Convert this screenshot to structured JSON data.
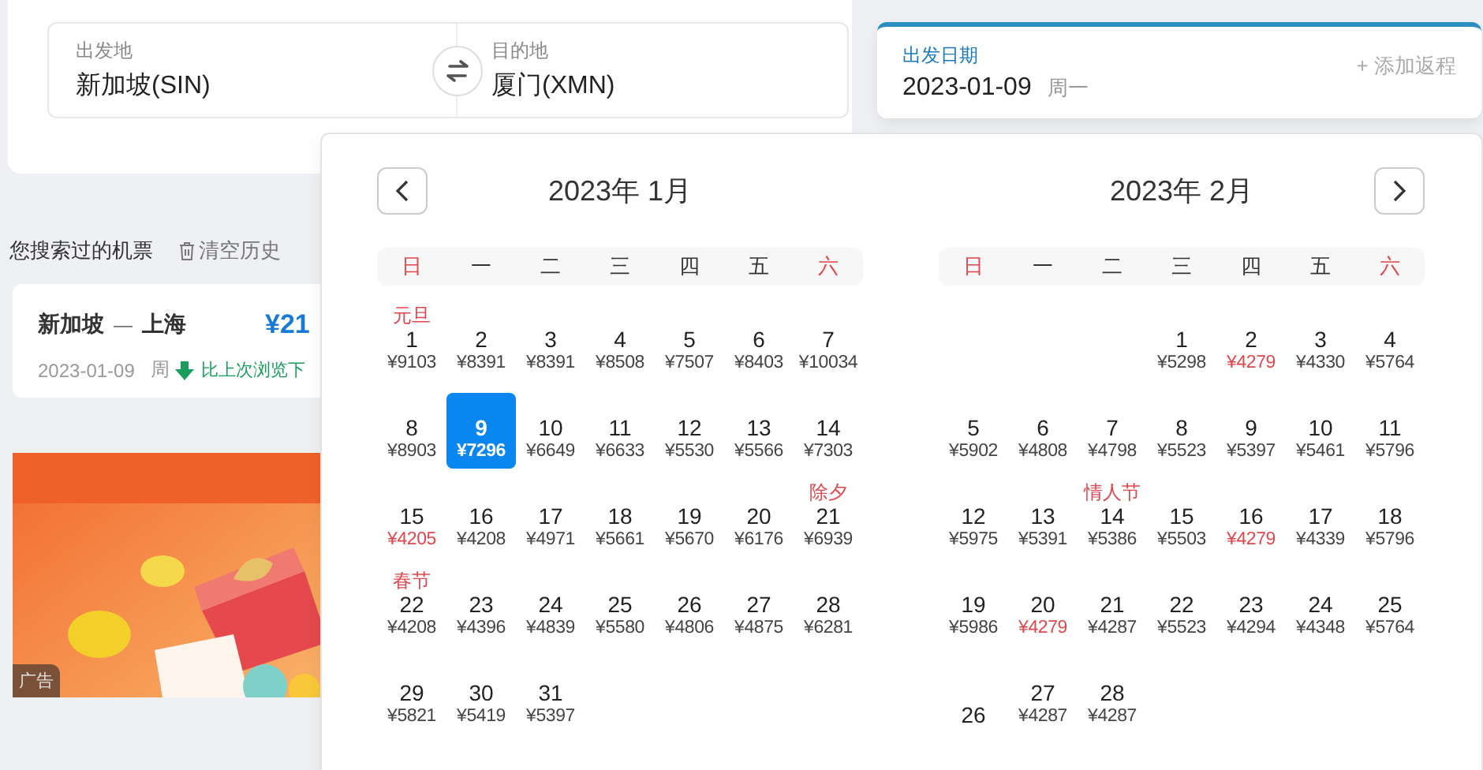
{
  "search": {
    "origin": {
      "label": "出发地",
      "value": "新加坡(SIN)"
    },
    "destination": {
      "label": "目的地",
      "value": "厦门(XMN)"
    },
    "date": {
      "label": "出发日期",
      "value": "2023-01-09",
      "weekday": "周一",
      "add_return": "+ 添加返程"
    }
  },
  "history": {
    "title": "您搜索过的机票",
    "clear": "清空历史",
    "items": [
      {
        "from": "新加坡",
        "separator": "—",
        "to": "上海",
        "price": "¥21",
        "date": "2023-01-09",
        "weekday": "周",
        "trend": "比上次浏览下"
      }
    ]
  },
  "ad": {
    "kind": "picture",
    "badge": "广告"
  },
  "calendar": {
    "months": [
      {
        "title": "2023年 1月",
        "weekdays": [
          {
            "label": "日",
            "weekend": true
          },
          {
            "label": "一",
            "weekend": false
          },
          {
            "label": "二",
            "weekend": false
          },
          {
            "label": "三",
            "weekend": false
          },
          {
            "label": "四",
            "weekend": false
          },
          {
            "label": "五",
            "weekend": false
          },
          {
            "label": "六",
            "weekend": true
          }
        ],
        "days": [
          {
            "kind": "day",
            "day": "1",
            "price": "¥9103",
            "holiday": "元旦",
            "low": false,
            "selected": false
          },
          {
            "kind": "day",
            "day": "2",
            "price": "¥8391",
            "low": false,
            "selected": false
          },
          {
            "kind": "day",
            "day": "3",
            "price": "¥8391",
            "low": false,
            "selected": false
          },
          {
            "kind": "day",
            "day": "4",
            "price": "¥8508",
            "low": false,
            "selected": false
          },
          {
            "kind": "day",
            "day": "5",
            "price": "¥7507",
            "low": false,
            "selected": false
          },
          {
            "kind": "day",
            "day": "6",
            "price": "¥8403",
            "low": false,
            "selected": false
          },
          {
            "kind": "day",
            "day": "7",
            "price": "¥10034",
            "low": false,
            "selected": false
          },
          {
            "kind": "day",
            "day": "8",
            "price": "¥8903",
            "low": false,
            "selected": false
          },
          {
            "kind": "day",
            "day": "9",
            "price": "¥7296",
            "low": false,
            "selected": true
          },
          {
            "kind": "day",
            "day": "10",
            "price": "¥6649",
            "low": false,
            "selected": false
          },
          {
            "kind": "day",
            "day": "11",
            "price": "¥6633",
            "low": false,
            "selected": false
          },
          {
            "kind": "day",
            "day": "12",
            "price": "¥5530",
            "low": false,
            "selected": false
          },
          {
            "kind": "day",
            "day": "13",
            "price": "¥5566",
            "low": false,
            "selected": false
          },
          {
            "kind": "day",
            "day": "14",
            "price": "¥7303",
            "low": false,
            "selected": false
          },
          {
            "kind": "day",
            "day": "15",
            "price": "¥4205",
            "low": true,
            "selected": false
          },
          {
            "kind": "day",
            "day": "16",
            "price": "¥4208",
            "low": false,
            "selected": false
          },
          {
            "kind": "day",
            "day": "17",
            "price": "¥4971",
            "low": false,
            "selected": false
          },
          {
            "kind": "day",
            "day": "18",
            "price": "¥5661",
            "low": false,
            "selected": false
          },
          {
            "kind": "day",
            "day": "19",
            "price": "¥5670",
            "low": false,
            "selected": false
          },
          {
            "kind": "day",
            "day": "20",
            "price": "¥6176",
            "low": false,
            "selected": false
          },
          {
            "kind": "day",
            "day": "21",
            "price": "¥6939",
            "holiday": "除夕",
            "low": false,
            "selected": false
          },
          {
            "kind": "day",
            "day": "22",
            "price": "¥4208",
            "holiday": "春节",
            "low": false,
            "selected": false
          },
          {
            "kind": "day",
            "day": "23",
            "price": "¥4396",
            "low": false,
            "selected": false
          },
          {
            "kind": "day",
            "day": "24",
            "price": "¥4839",
            "low": false,
            "selected": false
          },
          {
            "kind": "day",
            "day": "25",
            "price": "¥5580",
            "low": false,
            "selected": false
          },
          {
            "kind": "day",
            "day": "26",
            "price": "¥4806",
            "low": false,
            "selected": false
          },
          {
            "kind": "day",
            "day": "27",
            "price": "¥4875",
            "low": false,
            "selected": false
          },
          {
            "kind": "day",
            "day": "28",
            "price": "¥6281",
            "low": false,
            "selected": false
          },
          {
            "kind": "day",
            "day": "29",
            "price": "¥5821",
            "low": false,
            "selected": false
          },
          {
            "kind": "day",
            "day": "30",
            "price": "¥5419",
            "low": false,
            "selected": false
          },
          {
            "kind": "day",
            "day": "31",
            "price": "¥5397",
            "low": false,
            "selected": false
          }
        ]
      },
      {
        "title": "2023年 2月",
        "weekdays": [
          {
            "label": "日",
            "weekend": true
          },
          {
            "label": "一",
            "weekend": false
          },
          {
            "label": "二",
            "weekend": false
          },
          {
            "label": "三",
            "weekend": false
          },
          {
            "label": "四",
            "weekend": false
          },
          {
            "label": "五",
            "weekend": false
          },
          {
            "label": "六",
            "weekend": true
          }
        ],
        "days": [
          {
            "kind": "blank"
          },
          {
            "kind": "blank"
          },
          {
            "kind": "blank"
          },
          {
            "kind": "day",
            "day": "1",
            "price": "¥5298",
            "low": false,
            "selected": false
          },
          {
            "kind": "day",
            "day": "2",
            "price": "¥4279",
            "low": true,
            "selected": false
          },
          {
            "kind": "day",
            "day": "3",
            "price": "¥4330",
            "low": false,
            "selected": false
          },
          {
            "kind": "day",
            "day": "4",
            "price": "¥5764",
            "low": false,
            "selected": false
          },
          {
            "kind": "day",
            "day": "5",
            "price": "¥5902",
            "low": false,
            "selected": false
          },
          {
            "kind": "day",
            "day": "6",
            "price": "¥4808",
            "low": false,
            "selected": false
          },
          {
            "kind": "day",
            "day": "7",
            "price": "¥4798",
            "low": false,
            "selected": false
          },
          {
            "kind": "day",
            "day": "8",
            "price": "¥5523",
            "low": false,
            "selected": false
          },
          {
            "kind": "day",
            "day": "9",
            "price": "¥5397",
            "low": false,
            "selected": false
          },
          {
            "kind": "day",
            "day": "10",
            "price": "¥5461",
            "low": false,
            "selected": false
          },
          {
            "kind": "day",
            "day": "11",
            "price": "¥5796",
            "low": false,
            "selected": false
          },
          {
            "kind": "day",
            "day": "12",
            "price": "¥5975",
            "low": false,
            "selected": false
          },
          {
            "kind": "day",
            "day": "13",
            "price": "¥5391",
            "low": false,
            "selected": false
          },
          {
            "kind": "day",
            "day": "14",
            "price": "¥5386",
            "holiday": "情人节",
            "low": false,
            "selected": false
          },
          {
            "kind": "day",
            "day": "15",
            "price": "¥5503",
            "low": false,
            "selected": false
          },
          {
            "kind": "day",
            "day": "16",
            "price": "¥4279",
            "low": true,
            "selected": false
          },
          {
            "kind": "day",
            "day": "17",
            "price": "¥4339",
            "low": false,
            "selected": false
          },
          {
            "kind": "day",
            "day": "18",
            "price": "¥5796",
            "low": false,
            "selected": false
          },
          {
            "kind": "day",
            "day": "19",
            "price": "¥5986",
            "low": false,
            "selected": false
          },
          {
            "kind": "day",
            "day": "20",
            "price": "¥4279",
            "low": true,
            "selected": false
          },
          {
            "kind": "day",
            "day": "21",
            "price": "¥4287",
            "low": false,
            "selected": false
          },
          {
            "kind": "day",
            "day": "22",
            "price": "¥5523",
            "low": false,
            "selected": false
          },
          {
            "kind": "day",
            "day": "23",
            "price": "¥4294",
            "low": false,
            "selected": false
          },
          {
            "kind": "day",
            "day": "24",
            "price": "¥4348",
            "low": false,
            "selected": false
          },
          {
            "kind": "day",
            "day": "25",
            "price": "¥5764",
            "low": false,
            "selected": false
          },
          {
            "kind": "day",
            "day": "26",
            "selected": false
          },
          {
            "kind": "day",
            "day": "27",
            "price": "¥4287",
            "low": false,
            "selected": false
          },
          {
            "kind": "day",
            "day": "28",
            "price": "¥4287",
            "low": false,
            "selected": false
          }
        ]
      }
    ]
  }
}
